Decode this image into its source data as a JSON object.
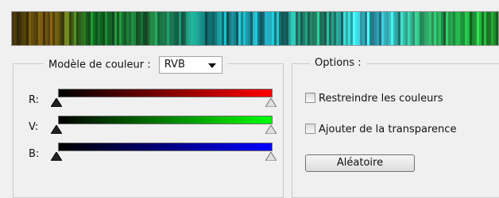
{
  "preview": {
    "label": "color-preview-strip"
  },
  "model_group": {
    "label": "Modèle de couleur :",
    "select_value": "RVB",
    "sliders": [
      {
        "label": "R:",
        "color": "#ff0000",
        "value_min": 0,
        "value_max": 1
      },
      {
        "label": "V:",
        "color": "#00ff00",
        "value_min": 0,
        "value_max": 1
      },
      {
        "label": "B:",
        "color": "#0000ff",
        "value_min": 0,
        "value_max": 1
      }
    ]
  },
  "options_group": {
    "label": "Options :",
    "checkbox_restrict": "Restreindre les couleurs",
    "checkbox_transparency": "Ajouter de la transparence",
    "random_button": "Aléatoire"
  }
}
